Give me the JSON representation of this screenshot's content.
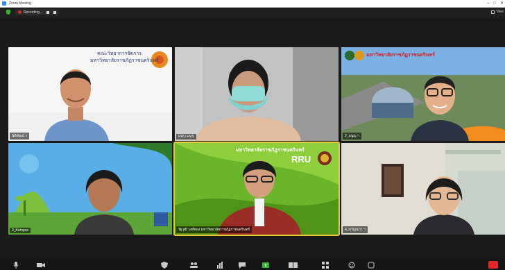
{
  "window": {
    "title": "Zoom Meeting",
    "controls": [
      "–",
      "□",
      "✕"
    ]
  },
  "topbar": {
    "recording_label": "Recording...",
    "view_label": "View"
  },
  "participants": [
    {
      "name": "นิติพัฒน์ ฯ",
      "banner_line1": "คณะวิทยาการจัดการ",
      "banner_line2": "มหาวิทยาลัยราชภัฏราชนครินทร์",
      "bg": "#f6f6f6"
    },
    {
      "name": "RRU FMS",
      "bg": "#bfbfbf"
    },
    {
      "name": "2_มนูญ ฯ",
      "banner_line1": "มหาวิทยาลัยราชภัฏราชนครินทร์",
      "bg": "#6fa3d8"
    },
    {
      "name": "3_Kompus",
      "bg": "#4a9ad9"
    },
    {
      "name": "รัฐวุฒิ วงศ์ทอง มหาวิทยาลัยราชภัฏราชนครินทร์",
      "banner_line1": "มหาวิทยาลัยราชภัฏราชนครินทร์",
      "banner_rru": "RRU",
      "bg": "#5aa51e"
    },
    {
      "name": "4_ขวัญนภา ฯ",
      "bg": "#e6e2da"
    }
  ],
  "colors": {
    "accent_active": "#e8c93a",
    "end_button": "#e02828",
    "security": "#2eb82e"
  }
}
